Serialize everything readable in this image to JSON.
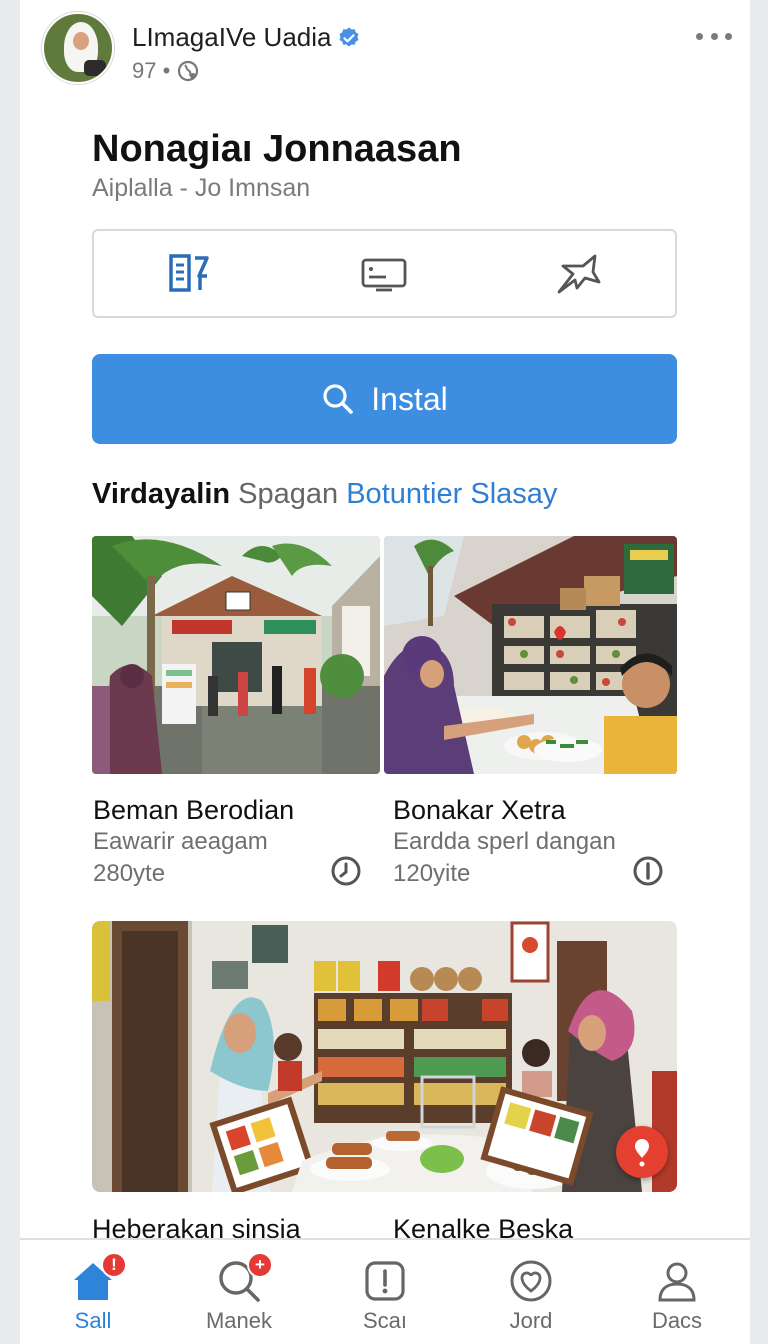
{
  "header": {
    "page_name": "LImagaIVe Uadia",
    "meta_text": "97 •",
    "more_icon": "more-dots-icon",
    "verified_icon": "verified-badge-icon"
  },
  "hero": {
    "title": "Nonagiaı Jonnaasan",
    "subtitle": "Aiplalla - Jo Imnsan"
  },
  "actions": [
    {
      "icon": "document-edit-icon"
    },
    {
      "icon": "screen-card-icon"
    },
    {
      "icon": "share-plane-icon"
    }
  ],
  "install_button": {
    "label": "Instal",
    "icon": "search-icon",
    "color": "#3d8de0"
  },
  "section": {
    "part_bold": "Virdayalin",
    "part_gray": "Spagan",
    "part_link": "Botuntier Slasay"
  },
  "items": [
    {
      "title": "Beman Berodian",
      "subtitle": "Eawarir aeagam",
      "price": "280yte",
      "icon": "timer-icon"
    },
    {
      "title": "Bonakar Xetra",
      "subtitle": "Eardda sperl dangan",
      "price": "120yite",
      "icon": "info-icon"
    }
  ],
  "bottom_items": [
    {
      "title": "Heberakan sinsia"
    },
    {
      "title": "Kenalke Beska"
    }
  ],
  "fab": {
    "icon": "exclamation-icon",
    "color": "#e53f2f"
  },
  "tabs": [
    {
      "label": "Sall",
      "icon": "home-icon",
      "badge": "!",
      "active": true
    },
    {
      "label": "Manek",
      "icon": "search-icon",
      "badge": "+"
    },
    {
      "label": "Scaı",
      "icon": "alert-square-icon"
    },
    {
      "label": "Jord",
      "icon": "heart-circle-icon"
    },
    {
      "label": "Dacs",
      "icon": "person-icon"
    }
  ],
  "colors": {
    "accent": "#2e84d8",
    "badge": "#e53935"
  }
}
